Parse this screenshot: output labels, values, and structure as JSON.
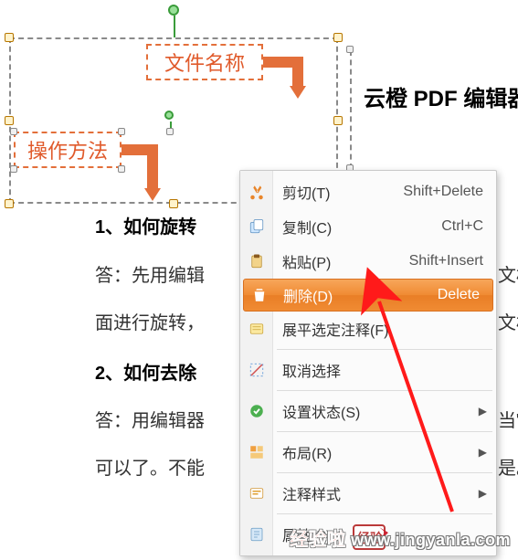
{
  "callouts": {
    "file_name_label": "文件名称",
    "method_label": "操作方法"
  },
  "heading": "云橙 PDF 编辑器",
  "body": {
    "q1": "1、如何旋转",
    "a1_line1": "答：先用编辑",
    "a1_line2": "面进行旋转，",
    "a1_line3_tail": "文档",
    "a1_line4_tail": "文档。",
    "q2": "2、如何去除",
    "a2_line1": "答：用编辑器",
    "a2_line1_tail": "当\" -",
    "a2_line2": "可以了。不能",
    "a2_line2_tail": "是。"
  },
  "menu": {
    "cut": {
      "label": "剪切(T)",
      "shortcut": "Shift+Delete"
    },
    "copy": {
      "label": "复制(C)",
      "shortcut": "Ctrl+C"
    },
    "paste": {
      "label": "粘贴(P)",
      "shortcut": "Shift+Insert"
    },
    "delete": {
      "label": "删除(D)",
      "shortcut": "Delete"
    },
    "flatten": {
      "label": "展平选定注释(F)"
    },
    "deselect": {
      "label": "取消选择"
    },
    "status": {
      "label": "设置状态(S)"
    },
    "layout": {
      "label": "布局(R)"
    },
    "annot_style": {
      "label": "注释样式"
    },
    "properties": {
      "label": "属性(P)..."
    }
  },
  "watermark": {
    "brand": "经验啦",
    "domain": "www.jingyanla.com"
  }
}
